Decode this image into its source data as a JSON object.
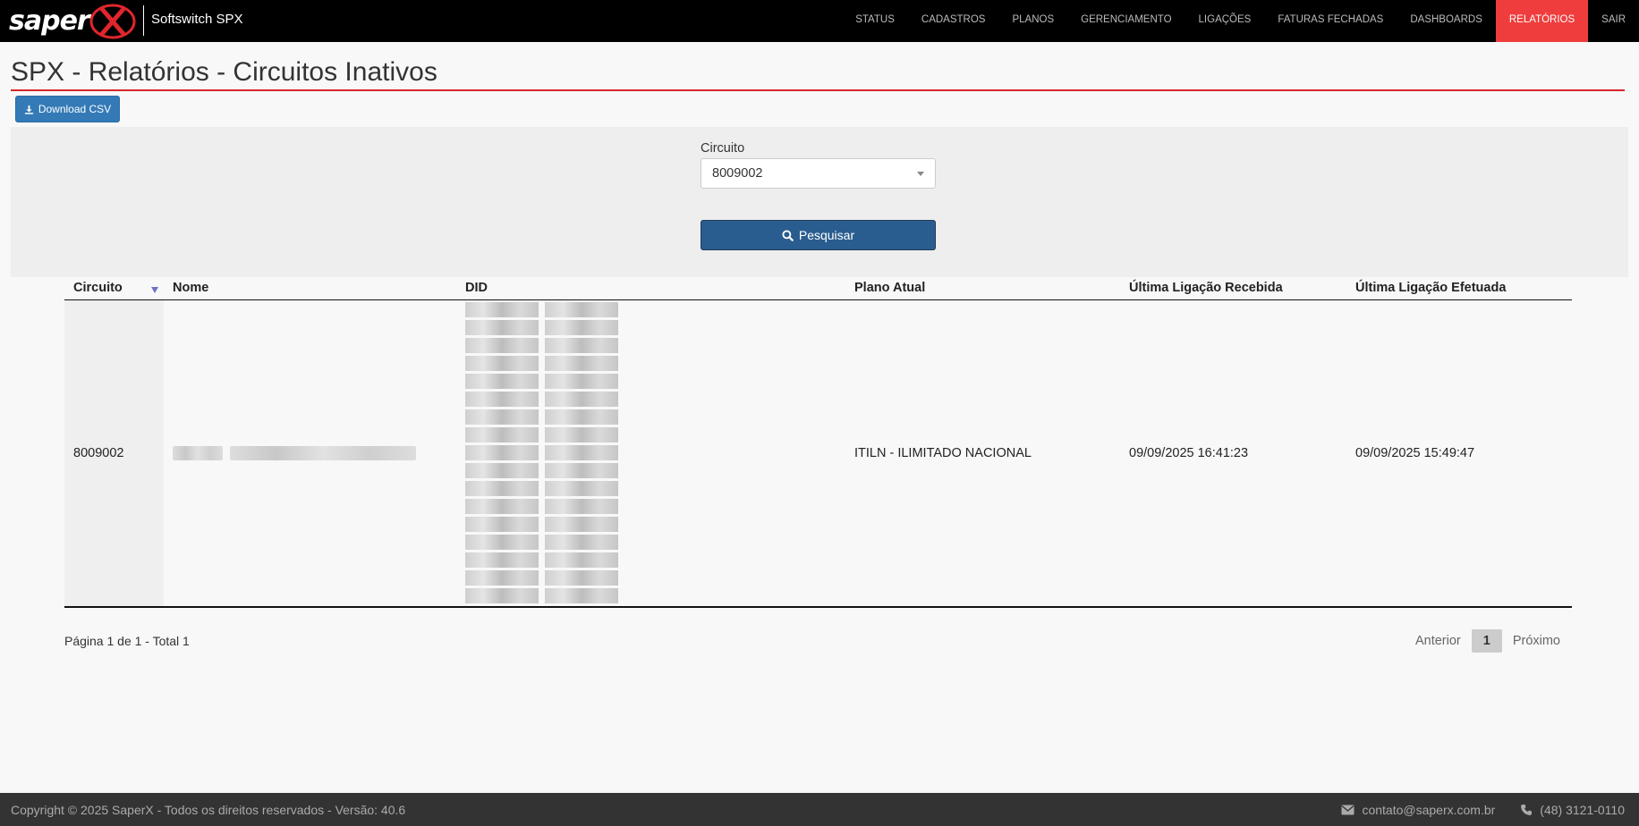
{
  "brand": {
    "logo_text": "saper",
    "logo_mark": "X",
    "app_name": "Softswitch SPX"
  },
  "nav": {
    "items": [
      {
        "label": "STATUS",
        "active": false
      },
      {
        "label": "CADASTROS",
        "active": false
      },
      {
        "label": "PLANOS",
        "active": false
      },
      {
        "label": "GERENCIAMENTO",
        "active": false
      },
      {
        "label": "LIGAÇÕES",
        "active": false
      },
      {
        "label": "FATURAS FECHADAS",
        "active": false
      },
      {
        "label": "DASHBOARDS",
        "active": false
      },
      {
        "label": "RELATÓRIOS",
        "active": true
      },
      {
        "label": "SAIR",
        "active": false
      }
    ]
  },
  "page": {
    "title": "SPX - Relatórios - Circuitos Inativos",
    "download_label": "Download CSV"
  },
  "filter": {
    "label": "Circuito",
    "selected_value": "8009002",
    "search_label": "Pesquisar"
  },
  "table": {
    "headers": [
      "Circuito",
      "Nome",
      "DID",
      "Plano Atual",
      "Última Ligação Recebida",
      "Última Ligação Efetuada"
    ],
    "rows": [
      {
        "circuito": "8009002",
        "plano": "ITILN - ILIMITADO NACIONAL",
        "ultima_recebida": "09/09/2025 16:41:23",
        "ultima_efetuada": "09/09/2025 15:49:47"
      }
    ]
  },
  "pagination": {
    "info": "Página 1 de 1 - Total 1",
    "prev_label": "Anterior",
    "current_page": "1",
    "next_label": "Próximo"
  },
  "footer": {
    "copyright": "Copyright © 2025 SaperX - Todos os direitos reservados - Versão: 40.6",
    "email": "contato@saperx.com.br",
    "phone": "(48) 3121-0110"
  },
  "icons": {
    "download": "download-icon",
    "search": "search-icon",
    "envelope": "envelope-icon",
    "phone": "phone-icon",
    "sort": "sort-desc-icon"
  },
  "colors": {
    "navbar_bg": "#000000",
    "nav_active": "#ef3d3d",
    "title_rule": "#d9262c",
    "primary_button": "#337ab7",
    "search_button": "#2a5d8f",
    "footer_bg": "#333333"
  }
}
